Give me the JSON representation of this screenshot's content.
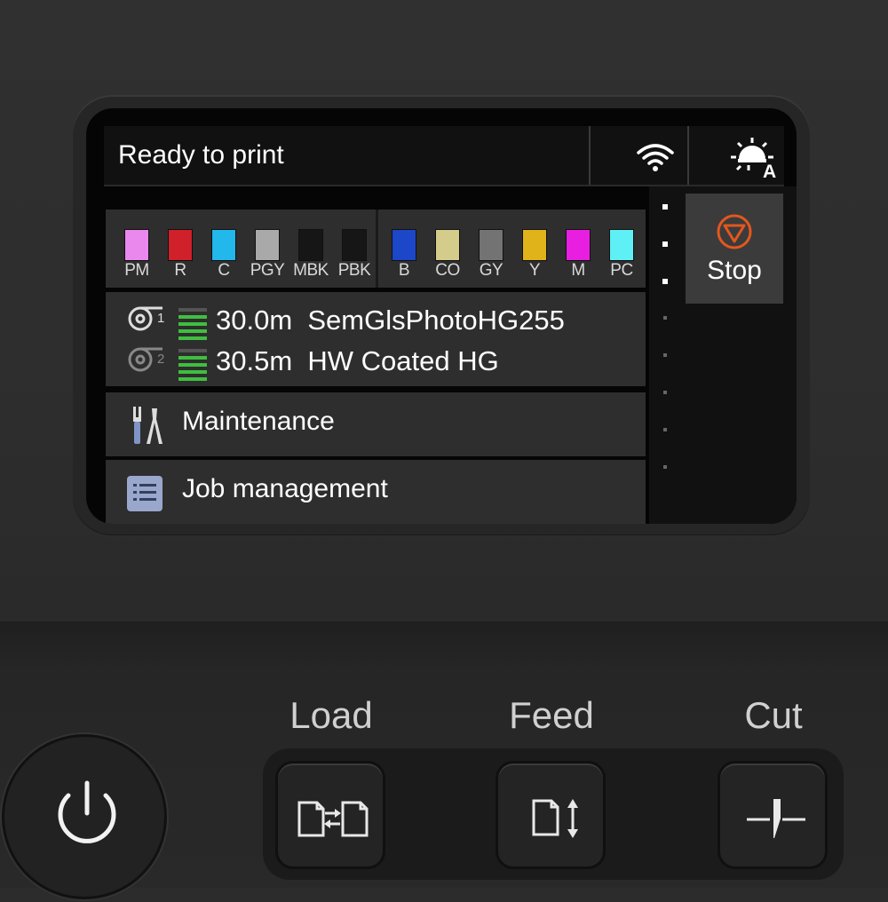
{
  "status": {
    "message": "Ready to print",
    "wifi_icon": "wifi-icon",
    "light_icon": "auto-light-icon"
  },
  "inks": {
    "left": [
      {
        "code": "PM",
        "color": "#ea88ee"
      },
      {
        "code": "R",
        "color": "#d0202a"
      },
      {
        "code": "C",
        "color": "#22b8ec"
      },
      {
        "code": "PGY",
        "color": "#a9a9a9"
      },
      {
        "code": "MBK",
        "color": "#161616"
      },
      {
        "code": "PBK",
        "color": "#161616"
      }
    ],
    "right": [
      {
        "code": "B",
        "color": "#1c47c8"
      },
      {
        "code": "CO",
        "color": "#d4cc8a"
      },
      {
        "code": "GY",
        "color": "#737373"
      },
      {
        "code": "Y",
        "color": "#e0b31a"
      },
      {
        "code": "M",
        "color": "#e81ee0"
      },
      {
        "code": "PC",
        "color": "#5ef0f4"
      }
    ]
  },
  "media": {
    "rolls": [
      {
        "number": "1",
        "text": "30.0m  SemGlsPhotoHG255",
        "level": 4
      },
      {
        "number": "2",
        "text": "30.5m  HW Coated HG",
        "level": 4
      }
    ]
  },
  "menu": {
    "maintenance": "Maintenance",
    "job_management": "Job management"
  },
  "stop": {
    "label": "Stop",
    "accent": "#e2571e"
  },
  "hardware": {
    "load_label": "Load",
    "feed_label": "Feed",
    "cut_label": "Cut"
  }
}
